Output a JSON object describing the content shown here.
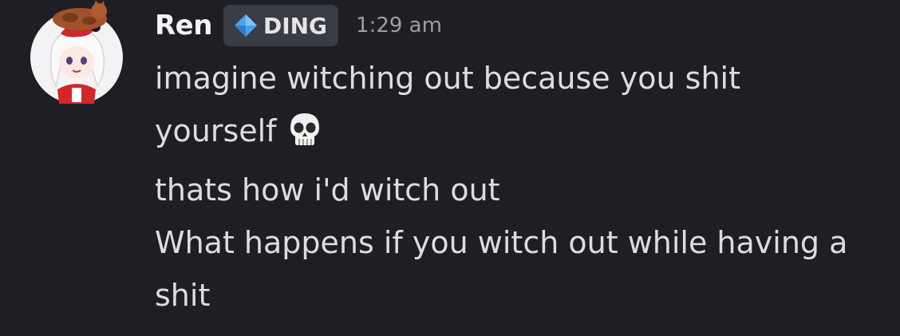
{
  "message": {
    "username": "Ren",
    "tag": {
      "label": "DING",
      "icon": "blue-diamond-icon"
    },
    "timestamp": "1:29 am",
    "lines": [
      "imagine witching out because you shit",
      "yourself",
      "thats how i'd witch out",
      "What happens if you witch out while having a",
      "shit"
    ],
    "emoji": "skull-emoji"
  }
}
